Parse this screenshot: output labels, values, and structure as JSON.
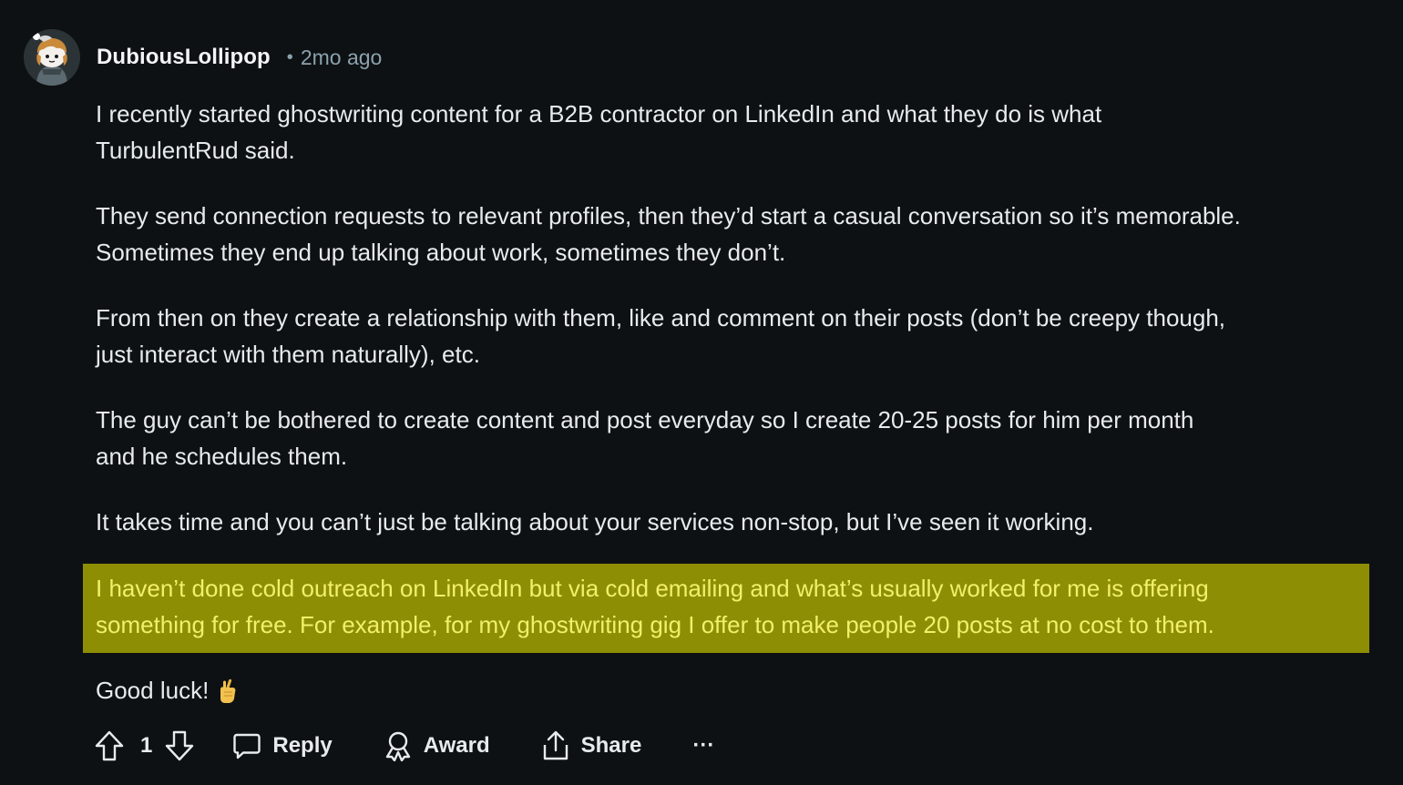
{
  "comment": {
    "username": "DubiousLollipop",
    "separator": "•",
    "timestamp": "2mo ago",
    "avatar_icon": "snoo-avatar-icon",
    "paragraphs": [
      "I recently started ghostwriting content for a B2B contractor on LinkedIn and what they do is what\nTurbulentRud said.",
      "They send connection requests to relevant profiles, then they’d start a casual conversation so it’s memorable.\nSometimes they end up talking about work, sometimes they don’t.",
      "From then on they create a relationship with them, like and comment on their posts (don’t be creepy though,\njust interact with them naturally), etc.",
      "The guy can’t be bothered to create content and post everyday so I create 20-25 posts for him per month\nand he schedules them.",
      "It takes time and you can’t just be talking about your services non-stop, but I’ve seen it working."
    ],
    "highlighted_paragraph": "I haven’t done cold outreach on LinkedIn but via cold emailing and what’s usually worked for me is offering\nsomething for free. For example, for my ghostwriting gig I offer to make people 20 posts at no cost to them.",
    "closing": "Good luck!",
    "closing_emoji": "crossed-fingers-emoji",
    "highlight_color": "#8e8e05",
    "highlight_text_color": "#f2ef6a"
  },
  "actions": {
    "vote_count": "1",
    "reply_label": "Reply",
    "award_label": "Award",
    "share_label": "Share",
    "more_label": "···"
  },
  "colors": {
    "background": "#0e1113",
    "text": "#e8ebed",
    "muted": "#8ba2ad"
  }
}
